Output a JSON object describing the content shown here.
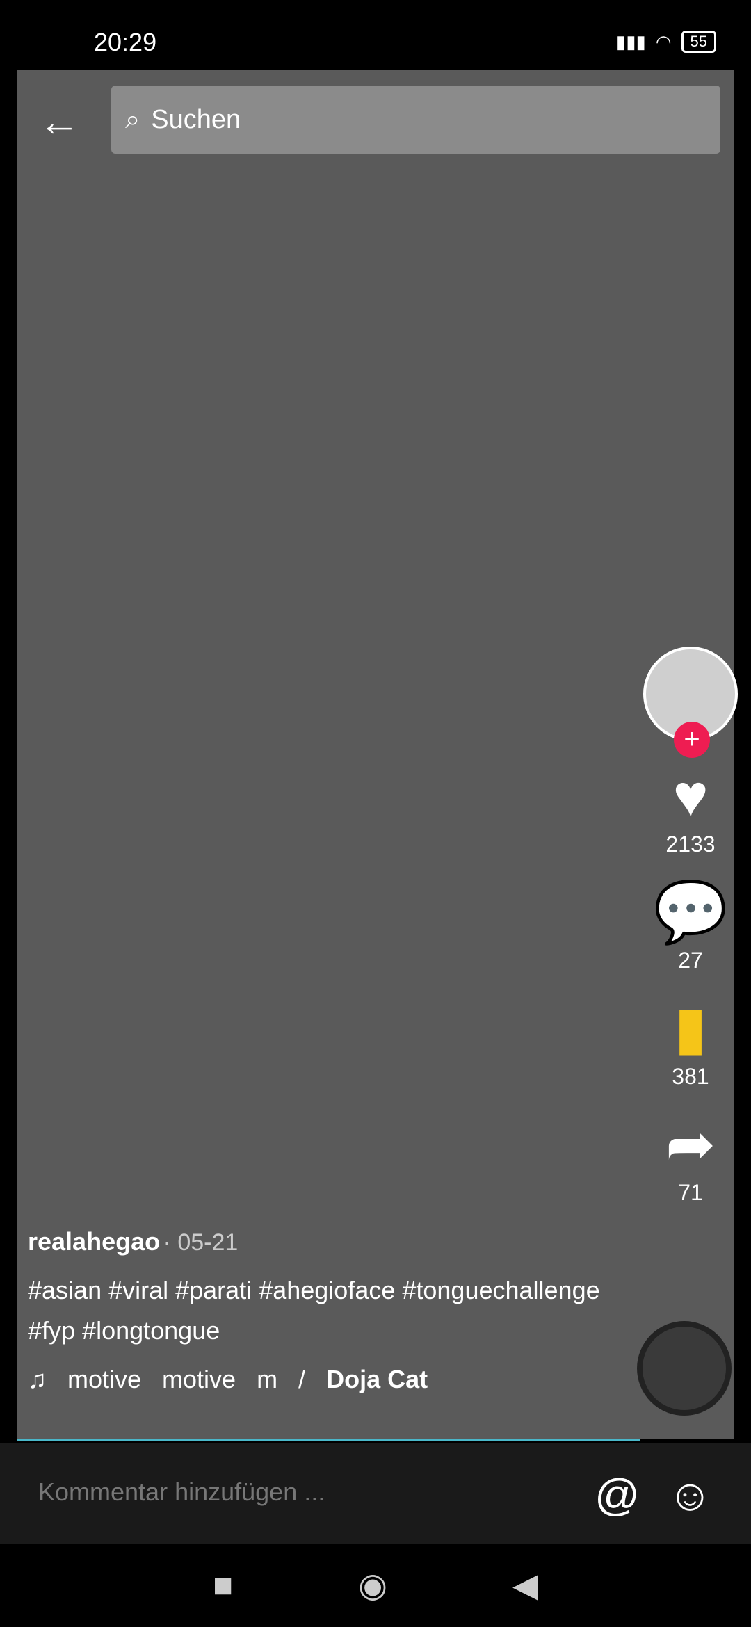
{
  "status": {
    "time": "20:29",
    "battery": "55"
  },
  "search": {
    "placeholder": "Suchen"
  },
  "video": {
    "note": ""
  },
  "rail": {
    "likes": "2133",
    "comments": "27",
    "saves": "381",
    "shares": "71"
  },
  "caption": {
    "username": "realahegao",
    "date": "· 05-21",
    "hashtags": "#asian #viral #parati #ahegioface #tonguechallenge #fyp #longtongue",
    "music": [
      "motive",
      "motive",
      "m",
      "/",
      "Doja Cat"
    ]
  },
  "comment": {
    "placeholder": "Kommentar hinzufügen ..."
  },
  "colors": {
    "follow": "#ee1d52",
    "save": "#f5c518",
    "progress": "#4ab7c9"
  }
}
